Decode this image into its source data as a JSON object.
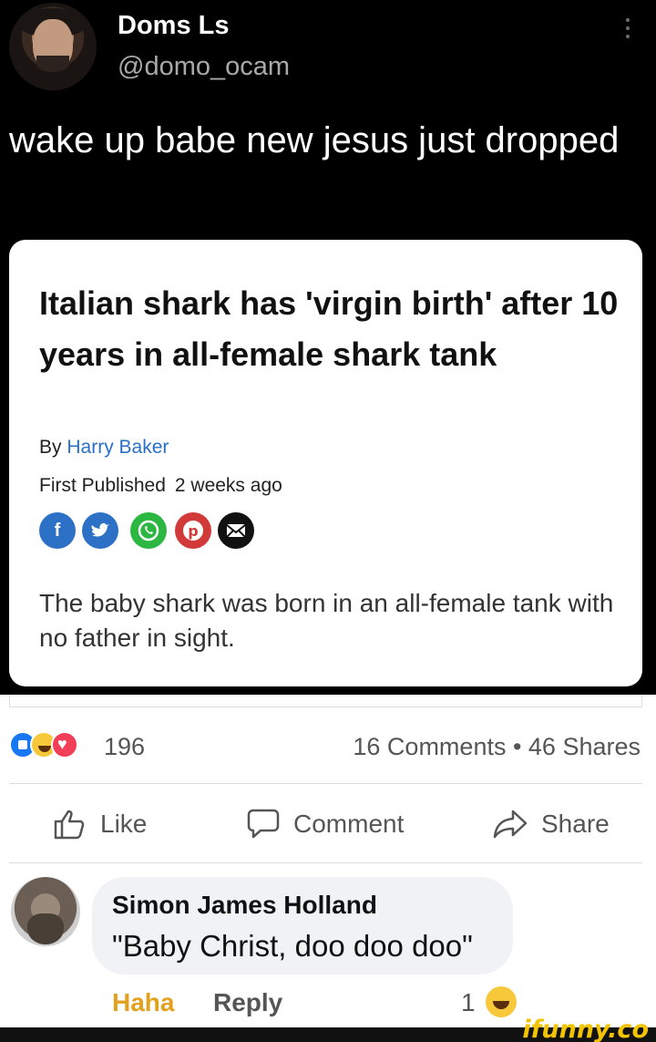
{
  "tweet": {
    "display_name": "Doms Ls",
    "handle": "@domo_ocam",
    "text": "wake up babe new jesus just dropped"
  },
  "article": {
    "headline": "Italian shark has 'virgin birth' after 10 years in all-female shark tank",
    "by_prefix": "By",
    "author": "Harry Baker",
    "published_label": "First Published",
    "published_when": "2 weeks ago",
    "share_icons": [
      "facebook-icon",
      "twitter-icon",
      "whatsapp-icon",
      "pinterest-icon",
      "email-icon"
    ],
    "lede": "The baby shark was born in an all-female tank with no father in sight."
  },
  "post": {
    "reaction_count": "196",
    "stats": "16 Comments • 46 Shares",
    "actions": {
      "like": "Like",
      "comment": "Comment",
      "share": "Share"
    }
  },
  "comment": {
    "author": "Simon James Holland",
    "text": "\"Baby Christ, doo doo doo\"",
    "haha_label": "Haha",
    "reply_label": "Reply",
    "reaction_count": "1"
  },
  "watermark": "ifunny.co",
  "colors": {
    "author_link": "#2a6fc9",
    "haha_active": "#e2a11d",
    "facebook_blue": "#1877f2",
    "watermark": "#f2c300"
  }
}
